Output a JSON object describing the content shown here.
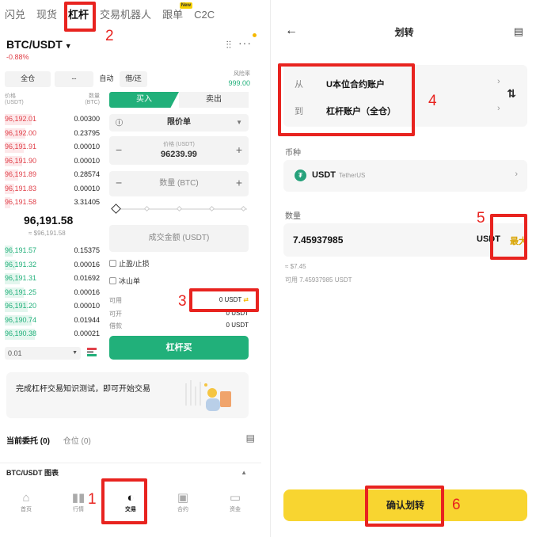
{
  "left": {
    "topnav": [
      "闪兑",
      "现货",
      "杠杆",
      "交易机器人",
      "跟单",
      "C2C"
    ],
    "new_badge": "New",
    "pair": "BTC/USDT",
    "change": "-0.88%",
    "modes": [
      "全仓",
      "--",
      "自动",
      "借/还"
    ],
    "risk_label": "风险率",
    "risk_value": "999.00",
    "ob_head": {
      "price": "价格",
      "price_unit": "(USDT)",
      "qty": "数量",
      "qty_unit": "(BTC)"
    },
    "asks": [
      {
        "p": "96,192.01",
        "q": "0.00300"
      },
      {
        "p": "96,192.00",
        "q": "0.23795"
      },
      {
        "p": "96,191.91",
        "q": "0.00010"
      },
      {
        "p": "96,191.90",
        "q": "0.00010"
      },
      {
        "p": "96,191.89",
        "q": "0.28574"
      },
      {
        "p": "96,191.83",
        "q": "0.00010"
      },
      {
        "p": "96,191.58",
        "q": "3.31405"
      }
    ],
    "last_price": "96,191.58",
    "last_fiat": "≈ $96,191.58",
    "bids": [
      {
        "p": "96,191.57",
        "q": "0.15375"
      },
      {
        "p": "96,191.32",
        "q": "0.00016"
      },
      {
        "p": "96,191.31",
        "q": "0.01692"
      },
      {
        "p": "96,191.25",
        "q": "0.00016"
      },
      {
        "p": "96,191.20",
        "q": "0.00010"
      },
      {
        "p": "96,190.74",
        "q": "0.01944"
      },
      {
        "p": "96,190.38",
        "q": "0.00021"
      }
    ],
    "precision": "0.01",
    "tab_buy": "买入",
    "tab_sell": "卖出",
    "order_type": "限价单",
    "price_label": "价格 (USDT)",
    "price_value": "96239.99",
    "qty_placeholder": "数量 (BTC)",
    "amount_placeholder": "成交金额 (USDT)",
    "check1": "止盈/止损",
    "check2": "冰山单",
    "avail_label": "可用",
    "avail_value": "0 USDT",
    "open_label": "可开",
    "open_value": "0 USDT",
    "borrow_label": "借款",
    "borrow_value": "0 USDT",
    "buy_button": "杠杆买",
    "promo_text": "完成杠杆交易知识测试，即可开始交易",
    "orders_tab": "当前委托 (0)",
    "positions_tab": "仓位 (0)",
    "chart_label": "BTC/USDT 图表",
    "bottom_nav": [
      "首页",
      "行情",
      "交易",
      "合约",
      "资金"
    ]
  },
  "right": {
    "title": "划转",
    "from_label": "从",
    "from_value": "U本位合约账户",
    "to_label": "到",
    "to_value": "杠杆账户（全仓）",
    "coin_label": "币种",
    "coin_symbol": "USDT",
    "coin_name": "TetherUS",
    "qty_label": "数量",
    "qty_value": "7.45937985",
    "qty_unit": "USDT",
    "max_label": "最大",
    "approx": "≈ $7.45",
    "available": "可用 7.45937985 USDT",
    "confirm": "确认划转"
  },
  "annotations": [
    "1",
    "2",
    "3",
    "4",
    "5",
    "6"
  ],
  "colors": {
    "buy": "#21b07a",
    "sell": "#e0414a",
    "accent": "#f8d530",
    "annotation": "#e8231f"
  }
}
